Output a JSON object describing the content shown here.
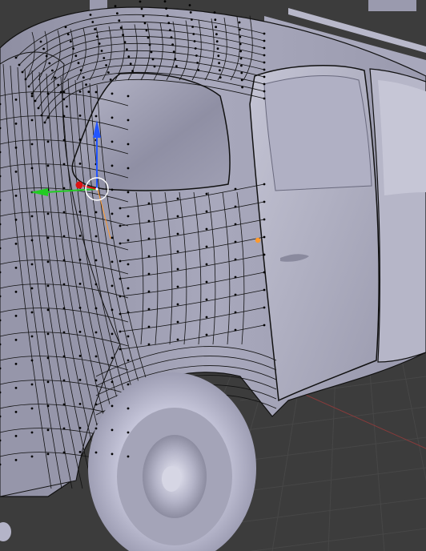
{
  "viewport": {
    "background": "#3c3c3c",
    "grid_color": "#474747",
    "x_axis_color": "#8a3b3b",
    "mesh_fill": "#a4a4b8",
    "mesh_shade": "#7d7d90",
    "wire_color": "#111111",
    "vertex_color": "#000000",
    "selected_vertex_color": "#ff9a2e"
  },
  "gizmo": {
    "z_color": "#2255ff",
    "y_color": "#22cc22",
    "x_color": "#dd1111",
    "cursor_color": "#ffffff",
    "icons": [
      "translate-gizmo-icon",
      "3d-cursor-icon"
    ]
  }
}
